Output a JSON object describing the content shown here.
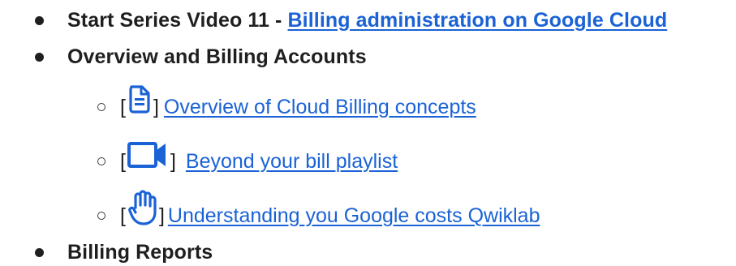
{
  "list": {
    "item1": {
      "prefix": "Start Series Video 11 - ",
      "link": "Billing administration on Google Cloud"
    },
    "item2": {
      "label": "Overview and Billing Accounts",
      "subitems": [
        {
          "icon": "document-icon",
          "bracket_open": "[",
          "bracket_close": "]",
          "link": "Overview of Cloud Billing concepts"
        },
        {
          "icon": "video-camera-icon",
          "bracket_open": "[",
          "bracket_close": "]",
          "link": "Beyond your bill playlist"
        },
        {
          "icon": "hand-icon",
          "bracket_open": "[",
          "bracket_close": "]",
          "link": "Understanding you Google costs Qwiklab"
        }
      ]
    },
    "item3": {
      "label": "Billing Reports"
    }
  },
  "colors": {
    "link": "#1a62d6",
    "icon": "#1a62d6",
    "text": "#1f1f1f"
  }
}
